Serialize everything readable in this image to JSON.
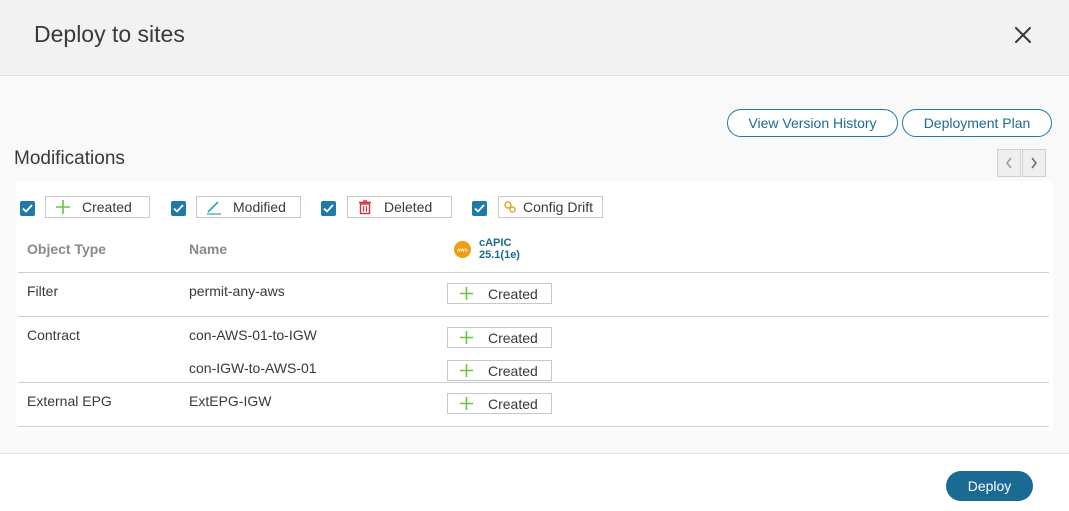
{
  "dialog": {
    "title": "Deploy to sites"
  },
  "actions": {
    "view_version_history": "View Version History",
    "deployment_plan": "Deployment Plan"
  },
  "section": {
    "title": "Modifications"
  },
  "filters": [
    {
      "label": "Created",
      "checked": true,
      "icon": "plus-icon"
    },
    {
      "label": "Modified",
      "checked": true,
      "icon": "pencil-icon"
    },
    {
      "label": "Deleted",
      "checked": true,
      "icon": "trash-icon"
    },
    {
      "label": "Config Drift",
      "checked": true,
      "icon": "config-drift-icon"
    }
  ],
  "table": {
    "headers": {
      "object_type": "Object Type",
      "name": "Name"
    },
    "site": {
      "icon_text": "aws",
      "name": "cAPIC",
      "version": "25.1(1e)"
    },
    "rows": [
      {
        "object_type": "Filter",
        "name": "permit-any-aws",
        "status": "Created"
      },
      {
        "object_type": "Contract",
        "name": "con-AWS-01-to-IGW",
        "status": "Created"
      },
      {
        "object_type": "",
        "name": "con-IGW-to-AWS-01",
        "status": "Created"
      },
      {
        "object_type": "External EPG",
        "name": "ExtEPG-IGW",
        "status": "Created"
      }
    ]
  },
  "footer": {
    "deploy": "Deploy"
  },
  "colors": {
    "accent": "#1b6a94",
    "created_green": "#6cc04a",
    "deleted_red": "#d0323d",
    "aws_orange": "#f39c12"
  }
}
